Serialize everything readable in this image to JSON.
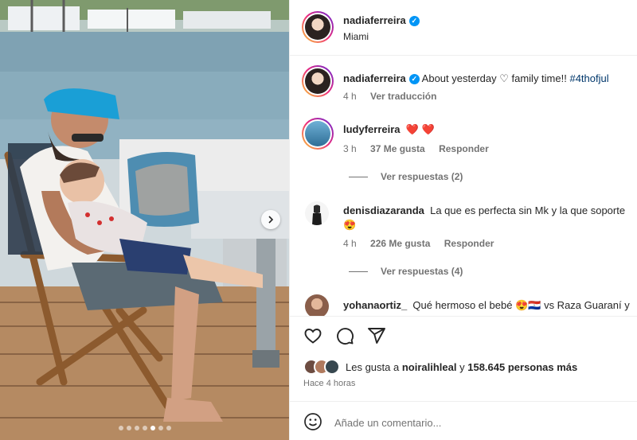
{
  "post": {
    "author": "nadiaferreira",
    "location": "Miami",
    "caption": "About yesterday ♡ family time!!",
    "hashtag": "#4thofjul",
    "caption_time": "4 h",
    "translate": "Ver traducción",
    "carousel": {
      "count": 7,
      "active_index": 4
    }
  },
  "comments": [
    {
      "user": "ludyferreira",
      "text": "❤️ ❤️",
      "time": "3 h",
      "likes": "37 Me gusta",
      "reply": "Responder",
      "replies": "Ver respuestas (2)"
    },
    {
      "user": "denisdiazaranda",
      "text": "La que es perfecta sin Mk y la que soporte",
      "text2": "😍",
      "time": "4 h",
      "likes": "226 Me gusta",
      "reply": "Responder",
      "replies": "Ver respuestas (4)"
    },
    {
      "user": "yohanaortiz_",
      "text": "Qué hermoso el bebé 😍🇵🇾",
      "text_tail": "vs Raza Guaraní y"
    }
  ],
  "likes": {
    "prefix": "Les gusta a",
    "user": "noiralihleal",
    "joiner": "y",
    "count": "158.645 personas más"
  },
  "timestamp": "Hace 4 horas",
  "add_comment": {
    "placeholder": "Añade un comentario..."
  },
  "icons": {
    "like": "heart-outline-icon",
    "comment": "speech-bubble-icon",
    "share": "paper-plane-icon",
    "emoji": "smiley-icon",
    "verified": "verified-badge-icon",
    "next": "chevron-right-icon"
  },
  "colors": {
    "verified": "#0095f6",
    "hashtag": "#00376b",
    "heart": "#ed4956",
    "muted": "#737373"
  }
}
